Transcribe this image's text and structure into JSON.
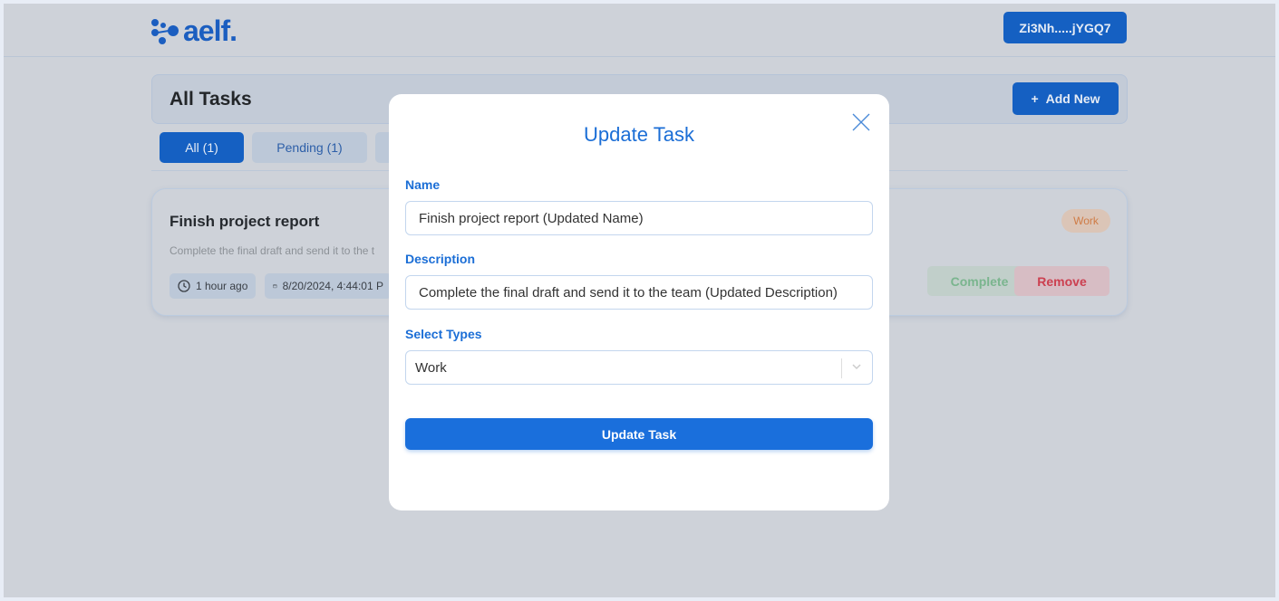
{
  "header": {
    "logo_text": "aelf.",
    "wallet": "Zi3Nh.....jYGQ7"
  },
  "tasks_bar": {
    "title": "All Tasks",
    "add_new": "Add New"
  },
  "tabs": [
    {
      "label": "All (1)",
      "active": true
    },
    {
      "label": "Pending (1)"
    }
  ],
  "task": {
    "name": "Finish project report",
    "description": "Complete the final draft and send it to the t",
    "time_ago": "1 hour ago",
    "date": "8/20/2024, 4:44:01 P",
    "type": "Work",
    "complete": "Complete",
    "remove": "Remove"
  },
  "modal": {
    "title": "Update Task",
    "name_label": "Name",
    "name_value": "Finish project report (Updated Name)",
    "description_label": "Description",
    "description_value": "Complete the final draft and send it to the team (Updated Description)",
    "types_label": "Select Types",
    "types_value": "Work",
    "submit": "Update Task"
  },
  "colors": {
    "primary": "#1a6fdc",
    "overlay_bg": "#ced2d9"
  }
}
